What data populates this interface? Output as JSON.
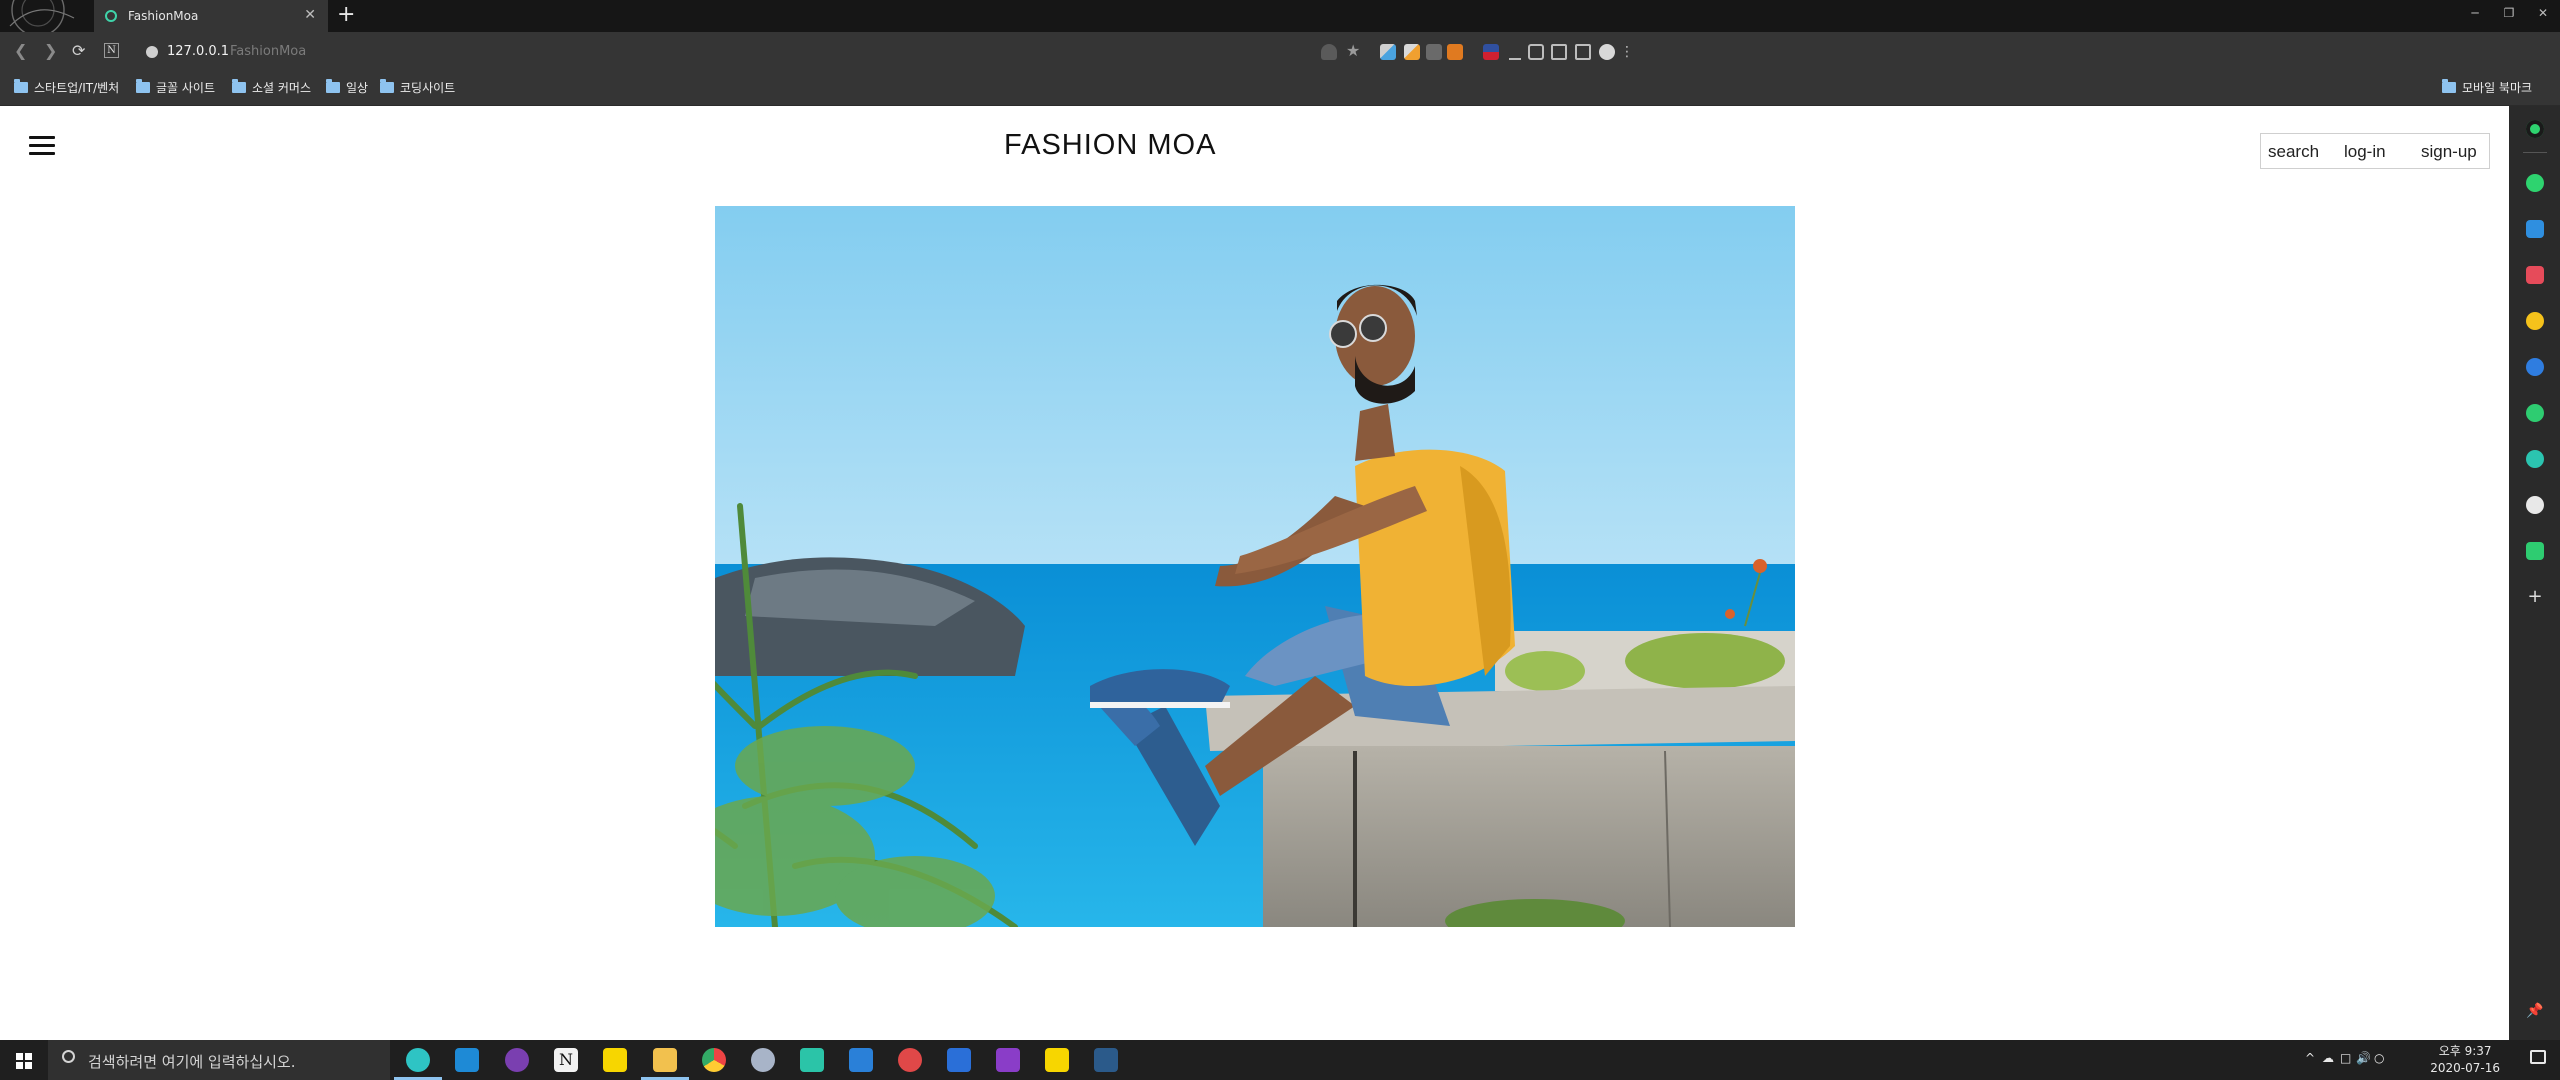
{
  "browser": {
    "tab_title": "FashionMoa",
    "url": "127.0.0.1",
    "url_title": "FashionMoa",
    "new_tab": "+",
    "close": "✕",
    "window_controls": [
      "─",
      "❐",
      "✕"
    ],
    "bookmarks": [
      "스타트업/IT/벤처",
      "글꼴 사이트",
      "소셜 커머스",
      "일상",
      "코딩사이트"
    ],
    "mobile_bookmarks": "모바일 북마크"
  },
  "page": {
    "brand": "FASHION MOA",
    "nav": {
      "search": "search",
      "login": "log-in",
      "signup": "sign-up"
    }
  },
  "taskbar": {
    "search_placeholder": "검색하려면 여기에 입력하십시오.",
    "time": "오후 9:37",
    "date": "2020-07-16"
  }
}
